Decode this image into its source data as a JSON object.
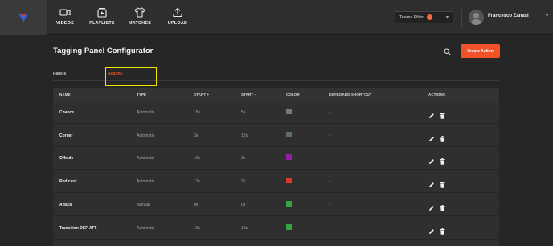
{
  "nav": {
    "items": [
      {
        "label": "VIDEOS",
        "icon": "video-camera-icon"
      },
      {
        "label": "PLAYLISTS",
        "icon": "playlist-icon"
      },
      {
        "label": "MATCHES",
        "icon": "jersey-icon"
      },
      {
        "label": "UPLOAD",
        "icon": "upload-icon"
      }
    ],
    "logo_icon": "app-logo-icon"
  },
  "teams_filter": {
    "label": "Teams Filter",
    "badge_color": "#f26a3e"
  },
  "user": {
    "name": "Francesco Zanasi"
  },
  "page": {
    "title": "Tagging Panel Configurator",
    "create_label": "Create Action"
  },
  "tabs": [
    {
      "label": "Panels",
      "active": false
    },
    {
      "label": "Actions",
      "active": true
    }
  ],
  "table": {
    "headers": [
      "NAME",
      "TYPE",
      "START +",
      "START -",
      "COLOR",
      "KEYBOARD SHORTCUT",
      "ACTIONS"
    ],
    "rows": [
      {
        "name": "Chance",
        "type": "Automatic",
        "start_plus": "15s",
        "start_minus": "5s",
        "color": "#7a7a7a",
        "shortcut": "-"
      },
      {
        "name": "Corner",
        "type": "Automatic",
        "start_plus": "3s",
        "start_minus": "12s",
        "color": "#5d6b73",
        "shortcut": "-"
      },
      {
        "name": "Offside",
        "type": "Automatic",
        "start_plus": "10s",
        "start_minus": "3s",
        "color": "#8e1fa6",
        "shortcut": "-"
      },
      {
        "name": "Red card",
        "type": "Automatic",
        "start_plus": "13s",
        "start_minus": "2s",
        "color": "#e3362b",
        "shortcut": "-"
      },
      {
        "name": "Attack",
        "type": "Manual",
        "start_plus": "0s",
        "start_minus": "0s",
        "color": "#37a345",
        "shortcut": "-"
      },
      {
        "name": "Transition DEF-ATT",
        "type": "Automatic",
        "start_plus": "10s",
        "start_minus": "10s",
        "color": "#37a345",
        "shortcut": "-"
      }
    ]
  },
  "colors": {
    "accent": "#f0532a",
    "highlight": "#f2e600"
  }
}
